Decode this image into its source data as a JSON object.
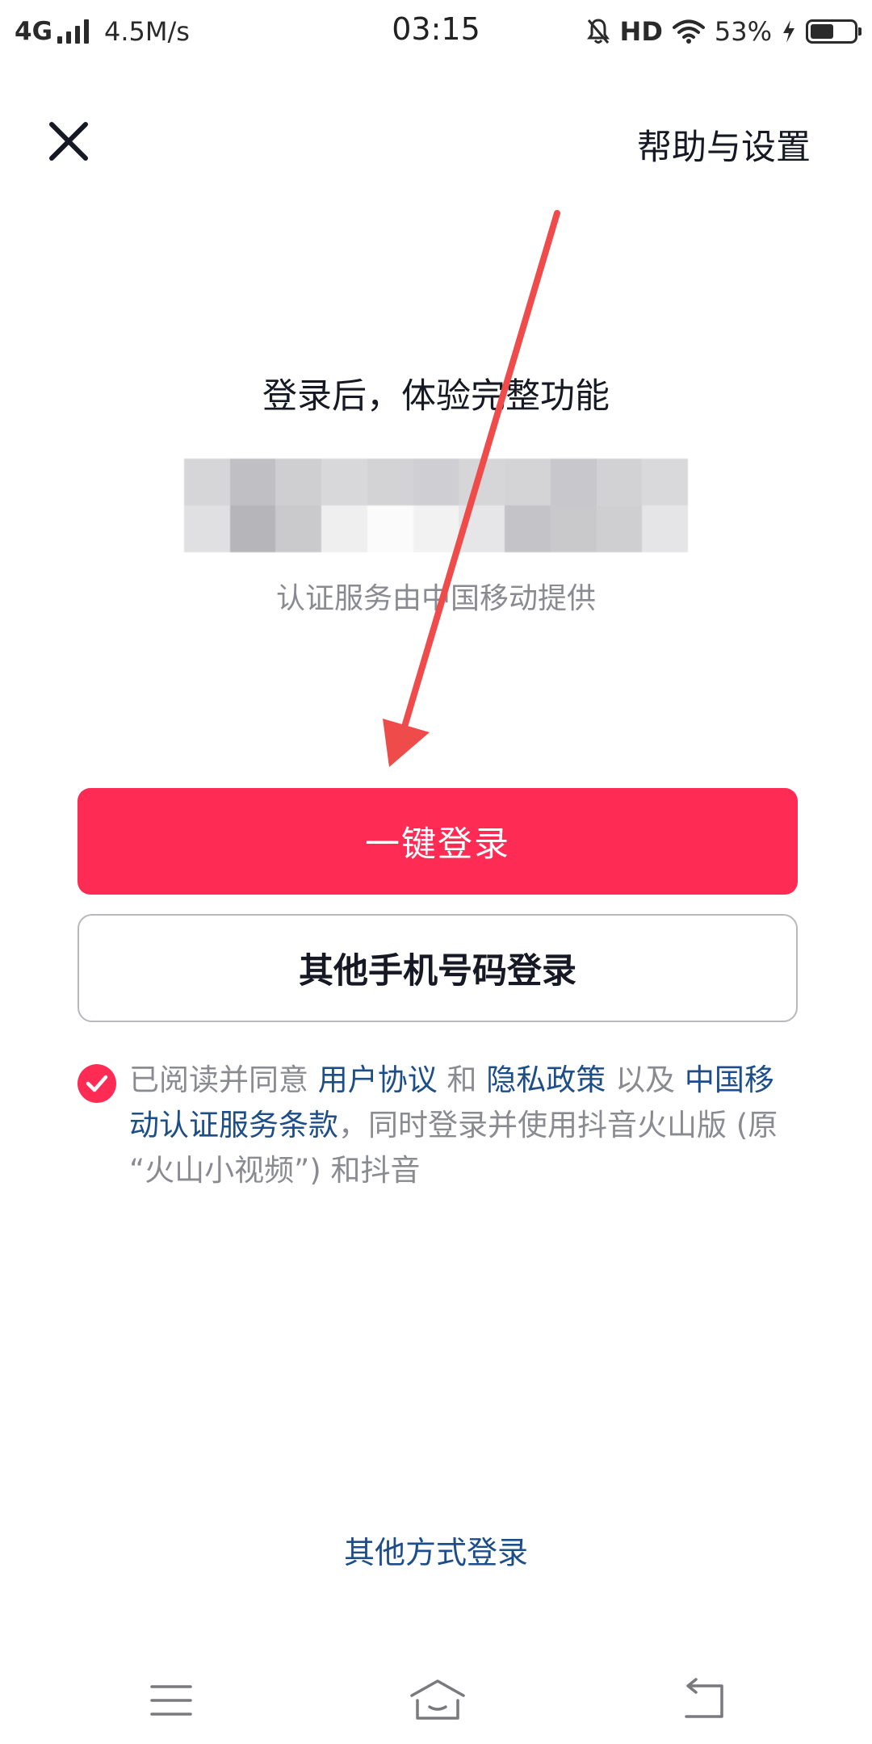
{
  "status_bar": {
    "network_type": "4G",
    "network_speed": "4.5M/s",
    "time": "03:15",
    "hd_label": "HD",
    "battery_percent": "53%",
    "battery_level": 0.53
  },
  "header": {
    "close_icon": "close-icon",
    "help_settings": "帮助与设置"
  },
  "main": {
    "headline": "登录后，体验完整功能",
    "provider_note": "认证服务由中国移动提供"
  },
  "buttons": {
    "one_click_login": "一键登录",
    "other_phone_login": "其他手机号码登录"
  },
  "agreement": {
    "checked": true,
    "prefix": "已阅读并同意",
    "user_agreement": "用户协议",
    "and_1": "和",
    "privacy_policy": "隐私政策",
    "and_2": "以及",
    "cmcc_terms": "中国移动认证服务条款",
    "suffix": "，同时登录并使用抖音火山版 (原 “火山小视频”) 和抖音"
  },
  "footer": {
    "other_methods": "其他方式登录"
  },
  "colors": {
    "primary": "#fe2c55",
    "link": "#1d4e89",
    "muted_text": "#8a8b91",
    "annotation_arrow": "#ef4b4b"
  }
}
